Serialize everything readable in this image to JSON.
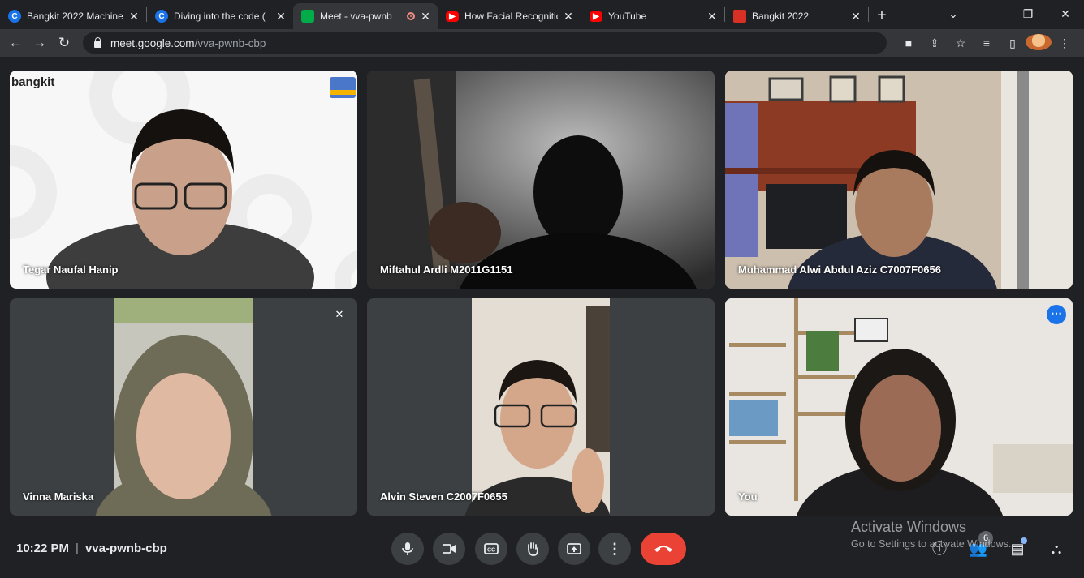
{
  "browser": {
    "tabs": [
      {
        "title": "Bangkit 2022 Machine",
        "favicon": "c-icon",
        "favicon_color": "#1a73e8",
        "active": false
      },
      {
        "title": "Diving into the code (",
        "favicon": "c-icon",
        "favicon_color": "#1a73e8",
        "active": false
      },
      {
        "title": "Meet - vva-pwnb",
        "favicon": "meet-icon",
        "favicon_color": "#00ac47",
        "active": true,
        "recording": true
      },
      {
        "title": "How Facial Recognitio",
        "favicon": "youtube-icon",
        "favicon_color": "#ff0000",
        "active": false
      },
      {
        "title": "YouTube",
        "favicon": "youtube-icon",
        "favicon_color": "#ff0000",
        "active": false
      },
      {
        "title": "Bangkit 2022",
        "favicon": "bangkit-icon",
        "favicon_color": "#d93025",
        "active": false
      }
    ],
    "url_host": "meet.google.com",
    "url_path": "/vva-pwnb-cbp"
  },
  "participants": [
    {
      "name": "Tegar Naufal Hanip"
    },
    {
      "name": "Miftahul Ardli M2011G1151"
    },
    {
      "name": "Muhammad Alwi Abdul Aziz C7007F0656"
    },
    {
      "name": "Vinna Mariska",
      "muted": true
    },
    {
      "name": "Alvin Steven C2007F0655"
    },
    {
      "name": "You"
    }
  ],
  "bangkit_logo": "bangkit",
  "meeting": {
    "time": "10:22 PM",
    "code": "vva-pwnb-cbp",
    "participant_count": "6"
  },
  "watermark": {
    "line1": "Activate Windows",
    "line2": "Go to Settings to activate Windows."
  },
  "colors": {
    "end_call": "#ea4335",
    "you_outline": "#8ab4f8",
    "more_button": "#1a73e8"
  }
}
